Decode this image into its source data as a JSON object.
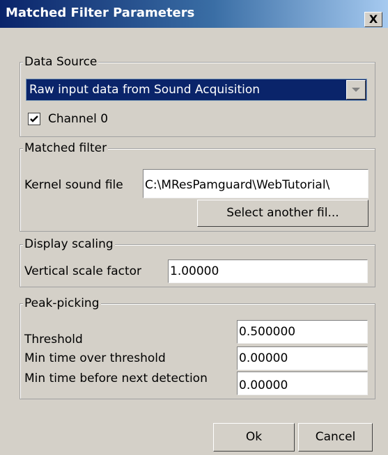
{
  "window": {
    "title": "Matched Filter Parameters",
    "close_label": "X"
  },
  "data_source": {
    "group_title": "Data Source",
    "selected_source": "Raw input data from Sound Acquisition",
    "channel_label": "Channel 0",
    "channel_checked": true
  },
  "matched_filter": {
    "group_title": "Matched filter",
    "kernel_label": "Kernel sound file",
    "kernel_value": "C:\\MResPamguard\\WebTutorial\\",
    "select_button": "Select another fil..."
  },
  "display_scaling": {
    "group_title": "Display scaling",
    "vertical_label": "Vertical scale factor",
    "vertical_value": "1.00000"
  },
  "peak_picking": {
    "group_title": "Peak-picking",
    "threshold_label": "Threshold",
    "threshold_value": "0.500000",
    "min_time_over_label": "Min time over threshold",
    "min_time_over_value": "0.00000",
    "min_time_before_label": "Min time before next detection",
    "min_time_before_value": "0.00000"
  },
  "buttons": {
    "ok": "Ok",
    "cancel": "Cancel"
  }
}
